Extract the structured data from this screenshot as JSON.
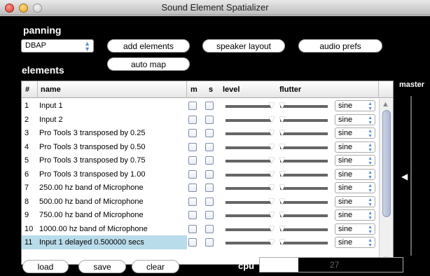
{
  "window": {
    "title": "Sound Element Spatializer"
  },
  "panning": {
    "label": "panning",
    "mode": "DBAP"
  },
  "buttons": {
    "add_elements": "add elements",
    "speaker_layout": "speaker layout",
    "audio_prefs": "audio prefs",
    "auto_map": "auto map",
    "load": "load",
    "save": "save",
    "clear": "clear"
  },
  "elements": {
    "label": "elements",
    "columns": {
      "num": "#",
      "name": "name",
      "m": "m",
      "s": "s",
      "level": "level",
      "flutter": "flutter"
    },
    "rows": [
      {
        "num": "1",
        "name": "Input 1",
        "wave": "sine",
        "selected": false
      },
      {
        "num": "2",
        "name": "Input 2",
        "wave": "sine",
        "selected": false
      },
      {
        "num": "3",
        "name": "Pro Tools 3 transposed by  0.25",
        "wave": "sine",
        "selected": false
      },
      {
        "num": "4",
        "name": "Pro Tools 3 transposed by  0.50",
        "wave": "sine",
        "selected": false
      },
      {
        "num": "5",
        "name": "Pro Tools 3 transposed by  0.75",
        "wave": "sine",
        "selected": false
      },
      {
        "num": "6",
        "name": "Pro Tools 3 transposed by  1.00",
        "wave": "sine",
        "selected": false
      },
      {
        "num": "7",
        "name": "  250.00 hz band of Microphone",
        "wave": "sine",
        "selected": false
      },
      {
        "num": "8",
        "name": "  500.00 hz band of Microphone",
        "wave": "sine",
        "selected": false
      },
      {
        "num": "9",
        "name": "  750.00 hz band of Microphone",
        "wave": "sine",
        "selected": false
      },
      {
        "num": "10",
        "name": "1000.00 hz band of Microphone",
        "wave": "sine",
        "selected": false
      },
      {
        "num": "11",
        "name": "Input 1 delayed 0.500000 secs",
        "wave": "sine",
        "selected": true
      }
    ]
  },
  "master": {
    "label": "master"
  },
  "cpu": {
    "label": "cpu",
    "value": "27",
    "level_fraction": 0.27
  }
}
